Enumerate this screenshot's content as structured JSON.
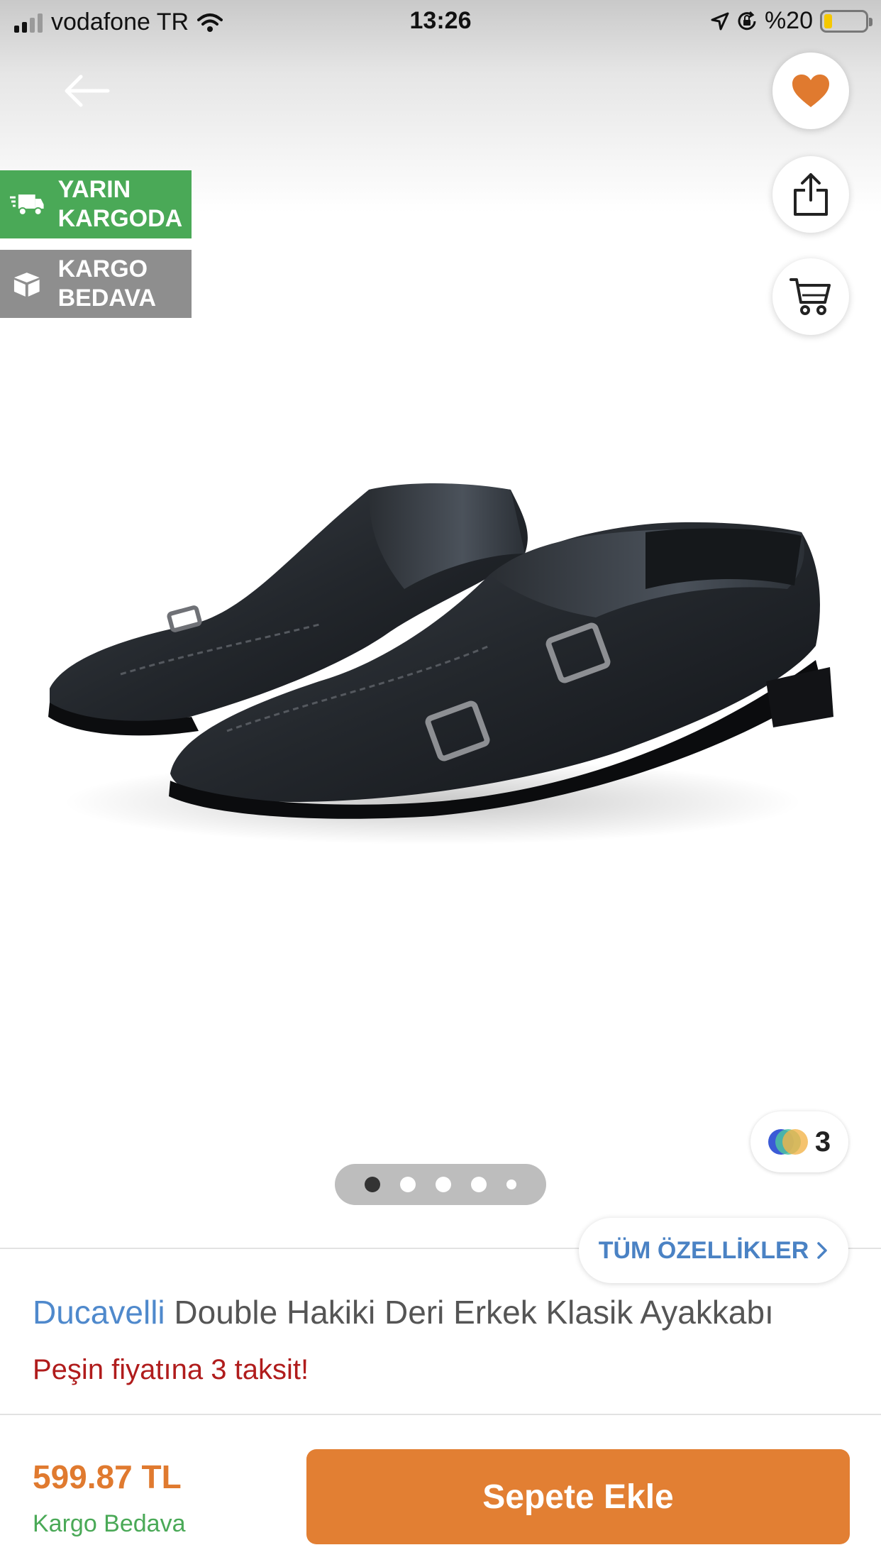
{
  "status_bar": {
    "carrier": "vodafone TR",
    "time": "13:26",
    "battery": "%20",
    "battery_level": 0.2
  },
  "badges": {
    "fast_shipping": [
      "YARIN",
      "KARGODA"
    ],
    "free_shipping": [
      "KARGO",
      "BEDAVA"
    ]
  },
  "gallery": {
    "color_count": "3",
    "page_count": 5,
    "active_page": 1
  },
  "all_features_label": "TÜM ÖZELLİKLER",
  "product": {
    "brand": "Ducavelli",
    "name": "Double Hakiki Deri Erkek Klasik Ayakkabı",
    "installment_text": "Peşin fiyatına 3 taksit!",
    "price": "599.87 TL",
    "shipping": "Kargo Bedava"
  },
  "add_to_cart_label": "Sepete Ekle",
  "colors": {
    "accent": "#e27f33",
    "green": "#4aa957",
    "brand_blue": "#4f89cc",
    "installment_red": "#b01c1c"
  }
}
